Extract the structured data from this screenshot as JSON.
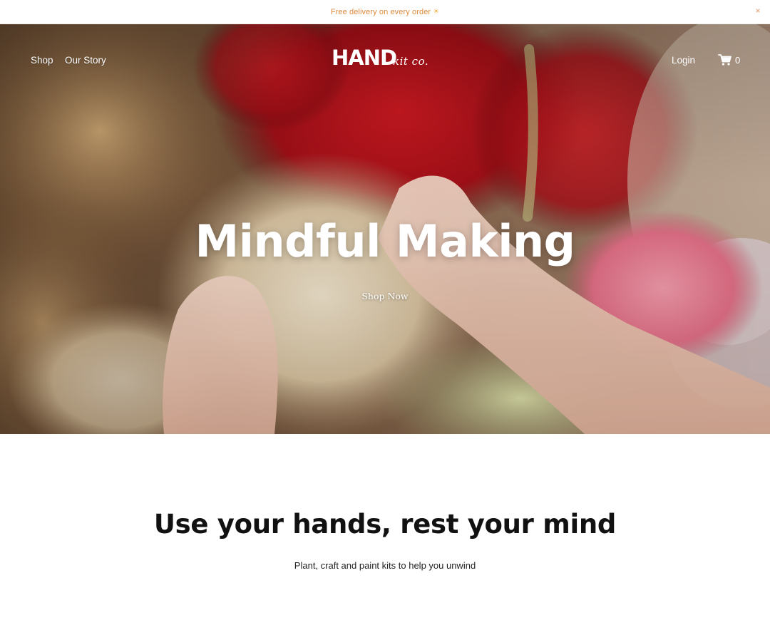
{
  "announcement": {
    "text": "Free delivery on every order",
    "sun_glyph": "☀",
    "close_glyph": "×"
  },
  "nav": {
    "shop": "Shop",
    "our_story": "Our Story",
    "login": "Login",
    "cart_count": "0"
  },
  "logo": {
    "primary": "HAND",
    "secondary": "kit co."
  },
  "hero": {
    "title": "Mindful Making",
    "cta": "Shop Now"
  },
  "intro": {
    "title": "Use your hands, rest your mind",
    "subtitle": "Plant, craft and paint kits to help you unwind"
  },
  "colors": {
    "announcement_text": "#e08a3c",
    "hero_red": "#c0141c",
    "hero_pink": "#e8889a",
    "hero_beige": "#d8c3a2"
  },
  "icons": {
    "close": "close-icon",
    "cart": "cart-icon",
    "sun": "sun-icon"
  }
}
